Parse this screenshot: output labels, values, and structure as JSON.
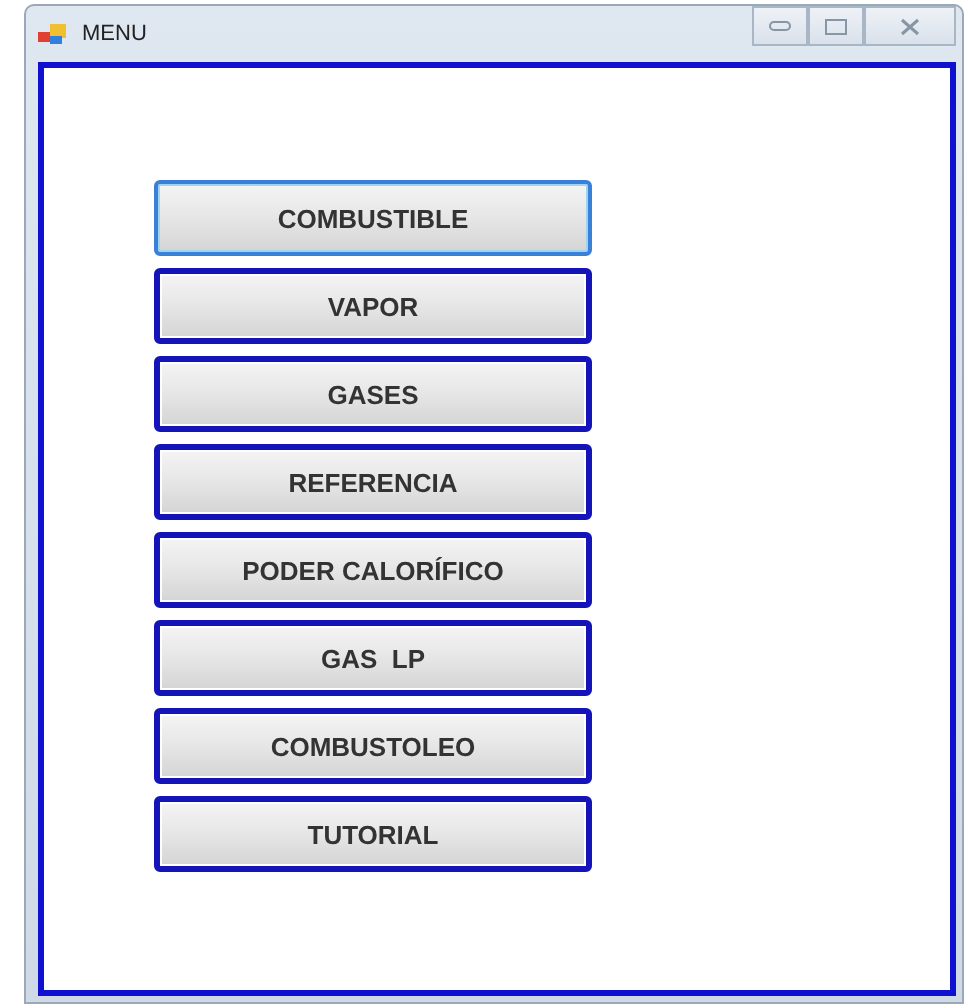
{
  "window": {
    "title": "MENU"
  },
  "buttons": [
    {
      "label": "COMBUSTIBLE",
      "focused": true
    },
    {
      "label": "VAPOR",
      "focused": false
    },
    {
      "label": "GASES",
      "focused": false
    },
    {
      "label": "REFERENCIA",
      "focused": false
    },
    {
      "label": "PODER CALORÍFICO",
      "focused": false
    },
    {
      "label": "GAS  LP",
      "focused": false
    },
    {
      "label": "COMBUSTOLEO",
      "focused": false
    },
    {
      "label": "TUTORIAL",
      "focused": false
    }
  ]
}
